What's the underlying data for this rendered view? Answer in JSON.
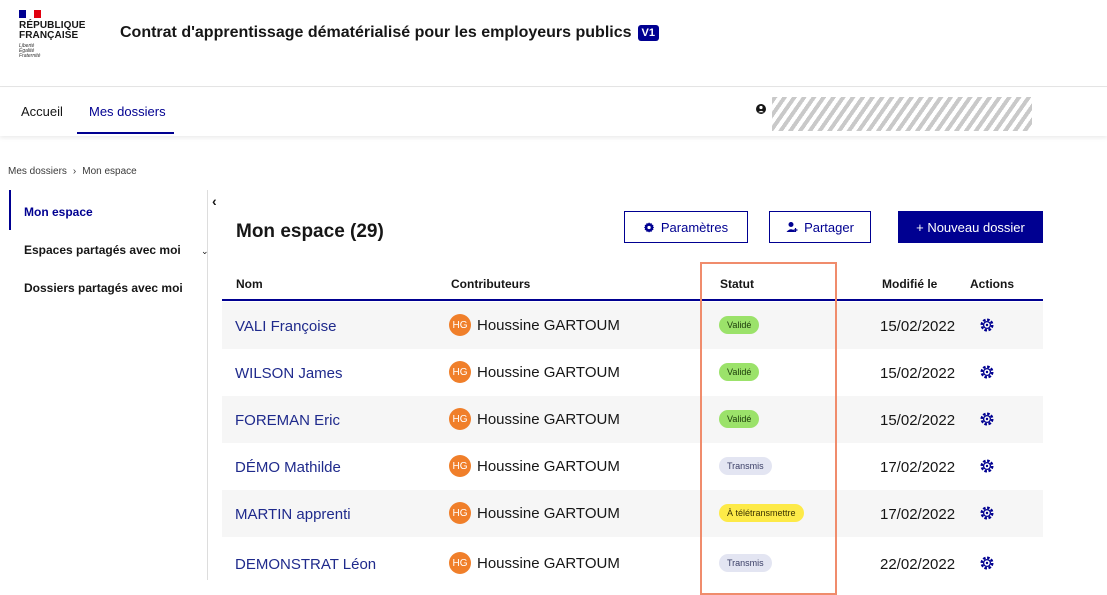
{
  "header": {
    "logo": {
      "line1": "RÉPUBLIQUE",
      "line2": "FRANÇAISE",
      "motto": [
        "Liberté",
        "Égalité",
        "Fraternité"
      ]
    },
    "title": "Contrat d'apprentissage dématérialisé pour les employeurs publics",
    "version_badge": "V1"
  },
  "nav": {
    "items": [
      "Accueil",
      "Mes dossiers"
    ],
    "active": "Mes dossiers"
  },
  "breadcrumb": {
    "items": [
      "Mes dossiers",
      "Mon espace"
    ],
    "separator": "›"
  },
  "sidebar": {
    "collapse_glyph": "‹",
    "items": [
      {
        "label": "Mon espace",
        "active": true
      },
      {
        "label": "Espaces partagés avec moi",
        "has_chevron": true
      },
      {
        "label": "Dossiers partagés avec moi"
      }
    ]
  },
  "main": {
    "title": "Mon espace (29)",
    "buttons": {
      "settings": "Paramètres",
      "share": "Partager",
      "new": "+ Nouveau dossier"
    }
  },
  "table": {
    "columns": [
      "Nom",
      "Contributeurs",
      "Statut",
      "Modifié le",
      "Actions"
    ],
    "rows": [
      {
        "name": "VALI Françoise",
        "initials": "HG",
        "contributor": "Houssine GARTOUM",
        "status": "Validé",
        "date": "15/02/2022"
      },
      {
        "name": "WILSON James",
        "initials": "HG",
        "contributor": "Houssine GARTOUM",
        "status": "Validé",
        "date": "15/02/2022"
      },
      {
        "name": "FOREMAN Eric",
        "initials": "HG",
        "contributor": "Houssine GARTOUM",
        "status": "Validé",
        "date": "15/02/2022"
      },
      {
        "name": "DÉMO Mathilde",
        "initials": "HG",
        "contributor": "Houssine GARTOUM",
        "status": "Transmis",
        "date": "17/02/2022"
      },
      {
        "name": "MARTIN apprenti",
        "initials": "HG",
        "contributor": "Houssine GARTOUM",
        "status": "À télétransmettre",
        "date": "17/02/2022"
      },
      {
        "name": "DEMONSTRAT Léon",
        "initials": "HG",
        "contributor": "Houssine GARTOUM",
        "status": "Transmis",
        "date": "22/02/2022"
      }
    ]
  },
  "colors": {
    "primary": "#000091",
    "valide": "#9be26a",
    "transmis": "#e3e5f2",
    "tele": "#fdea48",
    "avatar": "#f07f2a",
    "highlight": "#f08c6c"
  }
}
